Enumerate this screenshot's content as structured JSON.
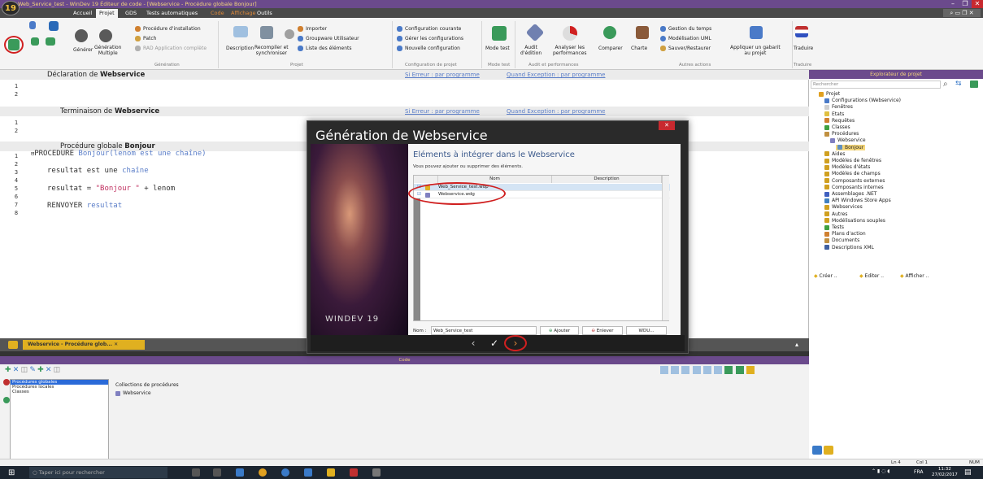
{
  "app": {
    "title": "Web_Service_test - WinDev 19  Éditeur de code - [Webservice - Procédure globale Bonjour]",
    "logo": "19"
  },
  "window_controls": {
    "min": "–",
    "max": "❐",
    "close": "✕"
  },
  "menu": {
    "tabs": [
      "Accueil",
      "Projet",
      "GDS",
      "Tests automatiques",
      "Code",
      "Affichage",
      "Outils"
    ],
    "active": "Projet"
  },
  "ribbon": {
    "generer": "Générer",
    "generation_multiple": "Génération\nMultiple",
    "procedure_installation": "Procédure d'installation",
    "patch": "Patch",
    "rad_app": "RAD Application complète",
    "description": "Description",
    "recompiler": "Recompiler et\nsynchroniser",
    "importer": "Importer",
    "groupware": "Groupware Utilisateur",
    "liste_elements": "Liste des éléments",
    "config_courante": "Configuration courante",
    "gerer_configs": "Gérer les configurations",
    "nouvelle_config": "Nouvelle configuration",
    "mode_test": "Mode test",
    "audit": "Audit\nd'édition",
    "analyser": "Analyser les\nperformances",
    "comparer": "Comparer",
    "charte": "Charte",
    "gestion_temps": "Gestion du temps",
    "modelisation_uml": "Modélisation UML",
    "sauver_restaurer": "Sauver/Restaurer",
    "appliquer_gabarit": "Appliquer un gabarit\nau projet",
    "traduire": "Traduire",
    "groups": [
      "Génération",
      "Projet",
      "Configuration de projet",
      "Mode test",
      "Audit et performances",
      "Autres actions",
      "Traduire"
    ]
  },
  "editor": {
    "sections": [
      {
        "label_prefix": "Déclaration de ",
        "label_bold": "Webservice",
        "link1": "Si Erreur : par programme",
        "link2": "Quand Exception : par programme"
      },
      {
        "label_prefix": "Terminaison de ",
        "label_bold": "Webservice",
        "link1": "Si Erreur : par programme",
        "link2": "Quand Exception : par programme"
      },
      {
        "label_prefix": "Procédure globale ",
        "label_bold": "Bonjour"
      }
    ],
    "line_numbers_1": [
      "1",
      "2"
    ],
    "line_numbers_2": [
      "1",
      "2"
    ],
    "line_numbers_3": [
      "1",
      "2",
      "3",
      "4",
      "5",
      "6",
      "7",
      "8"
    ],
    "code": {
      "l1_kw": "PROCEDURE",
      "l1_fn": "Bonjour(lenom est une chaîne)",
      "l3_a": "resultat est une ",
      "l3_b": "chaîne",
      "l5_a": "resultat = ",
      "l5_str": "\"Bonjour \"",
      "l5_b": " + lenom",
      "l7_kw": "RENVOYER",
      "l7_b": " resultat"
    }
  },
  "dialog": {
    "title": "Génération de Webservice",
    "subtitle": "Eléments à intégrer dans le Webservice",
    "hint": "Vous pouvez ajouter ou supprimer des éléments.",
    "col_name": "Nom",
    "col_desc": "Description",
    "rows": [
      "Web_Service_test.wdp",
      "Webservice.wdg"
    ],
    "nom_label": "Nom :",
    "nom_value": "Web_Service_test",
    "btn_ajouter": "Ajouter",
    "btn_enlever": "Enlever",
    "btn_wdu": "WDU...",
    "brand": "WINDEV 19",
    "nav_prev": "‹",
    "nav_ok": "✓",
    "nav_next": "›"
  },
  "explorer": {
    "header": "Explorateur de projet",
    "search_placeholder": "Rechercher",
    "items": [
      {
        "label": "Projet",
        "level": 0,
        "color": "#e0a020"
      },
      {
        "label": "Configurations (Webservice)",
        "level": 1,
        "color": "#4a7ac8"
      },
      {
        "label": "Fenêtres",
        "level": 1,
        "color": "#d0d0d0"
      },
      {
        "label": "Etats",
        "level": 1,
        "color": "#e0c040"
      },
      {
        "label": "Requêtes",
        "level": 1,
        "color": "#d08030"
      },
      {
        "label": "Classes",
        "level": 1,
        "color": "#40a040"
      },
      {
        "label": "Procédures",
        "level": 1,
        "color": "#c09040"
      },
      {
        "label": "Webservice",
        "level": 2,
        "color": "#8080c0"
      },
      {
        "label": "Bonjour",
        "level": 3,
        "color": "#6090c0",
        "selected": true
      },
      {
        "label": "Aides",
        "level": 1,
        "color": "#d0a020"
      },
      {
        "label": "Modèles de fenêtres",
        "level": 1,
        "color": "#d0a020"
      },
      {
        "label": "Modèles d'états",
        "level": 1,
        "color": "#d0a020"
      },
      {
        "label": "Modèles de champs",
        "level": 1,
        "color": "#d0a020"
      },
      {
        "label": "Composants externes",
        "level": 1,
        "color": "#d0a020"
      },
      {
        "label": "Composants internes",
        "level": 1,
        "color": "#d0a020"
      },
      {
        "label": "Assemblages .NET",
        "level": 1,
        "color": "#4060c0"
      },
      {
        "label": "API Windows Store Apps",
        "level": 1,
        "color": "#4080c0"
      },
      {
        "label": "Webservices",
        "level": 1,
        "color": "#d0a020"
      },
      {
        "label": "Autres",
        "level": 1,
        "color": "#d0a020"
      },
      {
        "label": "Modélisations souples",
        "level": 1,
        "color": "#d0a020"
      },
      {
        "label": "Tests",
        "level": 1,
        "color": "#40a040"
      },
      {
        "label": "Plans d'action",
        "level": 1,
        "color": "#d08030"
      },
      {
        "label": "Documents",
        "level": 1,
        "color": "#c09040"
      },
      {
        "label": "Descriptions XML",
        "level": 1,
        "color": "#4060a0"
      }
    ],
    "btn_creer": "Créer ..",
    "btn_editer": "Editer ..",
    "btn_afficher": "Afficher .."
  },
  "task": {
    "tab_label": "Webservice - Procédure glob...",
    "codebar": "Code",
    "list": [
      "Procédures globales",
      "Procédures locales",
      "Classes"
    ],
    "collection_title": "Collections de procédures",
    "collection_item": "Webservice"
  },
  "status": {
    "ln": "Ln 4",
    "col": "Col 1",
    "num": "NUM"
  },
  "taskbar": {
    "search": "Taper ici pour rechercher",
    "lang": "FRA",
    "time": "11:32",
    "date": "27/02/2017"
  }
}
